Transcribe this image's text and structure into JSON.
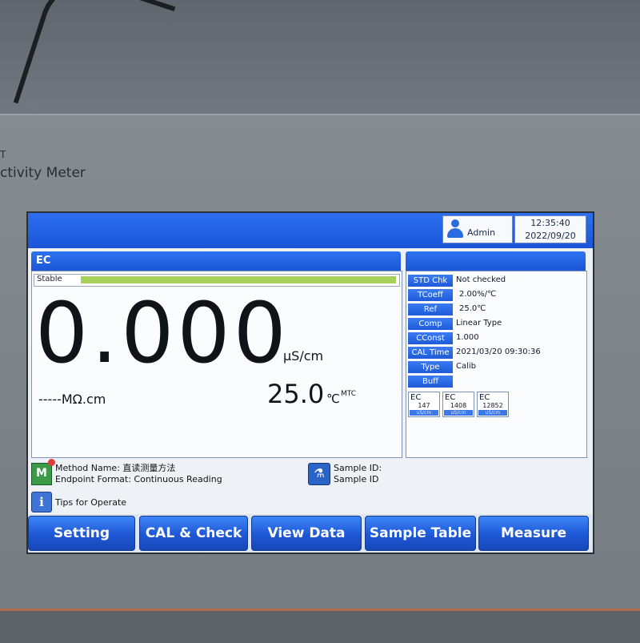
{
  "device": {
    "brand_fragment": "T",
    "model_fragment": "ctivity Meter"
  },
  "header": {
    "user": "Admin",
    "time": "12:35:40",
    "date": "2022/09/20"
  },
  "main": {
    "title": "EC",
    "stability_label": "Stable",
    "stability_fraction": 1.0,
    "reading_value": "0.000",
    "reading_unit": "µS/cm",
    "resistivity_value": "-----",
    "resistivity_unit": "MΩ.cm",
    "temperature_value": "25.0",
    "temperature_unit": "℃",
    "temperature_mode": "MTC"
  },
  "info": {
    "rows": [
      {
        "key": "STD Chk",
        "value": "Not checked"
      },
      {
        "key": "TCoeff",
        "value": "2.00%/℃"
      },
      {
        "key": "Ref",
        "value": "25.0℃"
      },
      {
        "key": "Comp",
        "value": "Linear Type"
      },
      {
        "key": "CConst",
        "value": "1.000"
      },
      {
        "key": "CAL Time",
        "value": "2021/03/20 09:30:36"
      },
      {
        "key": "Type",
        "value": "Calib"
      },
      {
        "key": "Buff",
        "value": ""
      }
    ],
    "buffers": [
      {
        "label": "EC",
        "value": "147",
        "unit": "uS/cm"
      },
      {
        "label": "EC",
        "value": "1408",
        "unit": "uS/cm"
      },
      {
        "label": "EC",
        "value": "12852",
        "unit": "uS/cm"
      }
    ]
  },
  "status": {
    "method_line": "Method Name: 直读测量方法",
    "endpoint_line": "Endpoint Format: Continuous Reading",
    "sample_id_line": "Sample ID:",
    "sample_id_value": "Sample ID",
    "tips": "Tips for Operate",
    "method_icon": "M"
  },
  "buttons": {
    "setting": "Setting",
    "cal_check": "CAL & Check",
    "view_data": "View Data",
    "sample_table": "Sample Table",
    "measure": "Measure"
  },
  "colors": {
    "title_bar": "#1f5bd9",
    "stable_fill": "#a6d25c",
    "button": "#1e57d5"
  }
}
